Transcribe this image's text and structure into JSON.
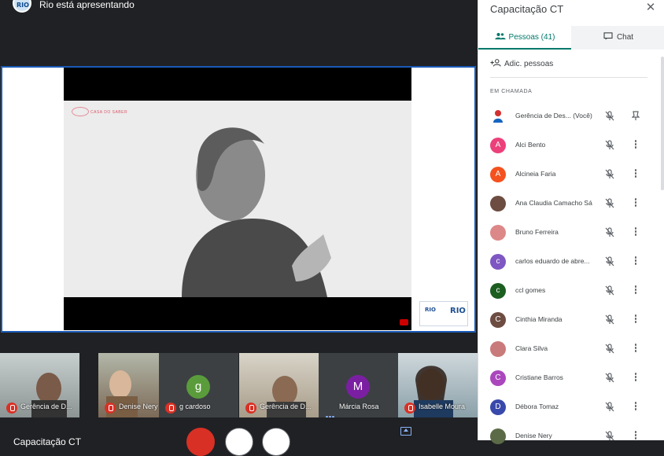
{
  "header": {
    "logo_text": "RIO",
    "presenting_text": "Rio está apresentando"
  },
  "video": {
    "brand_text": "CASA DO SABER",
    "badge_left": "RIO",
    "badge_right": "RIO"
  },
  "tiles": [
    {
      "name": "Gerência de D...",
      "muted": true,
      "avatar": "",
      "avatar_color": ""
    },
    {
      "name": "Denise Nery",
      "muted": true,
      "avatar": "",
      "avatar_color": ""
    },
    {
      "name": "g cardoso",
      "muted": true,
      "avatar": "g",
      "avatar_color": "#5a9c3b"
    },
    {
      "name": "Gerência de D...",
      "muted": true,
      "avatar": "",
      "avatar_color": ""
    },
    {
      "name": "Márcia Rosa",
      "muted": false,
      "avatar": "M",
      "avatar_color": "#7b1fa2"
    },
    {
      "name": "Isabelle Moura",
      "muted": true,
      "avatar": "",
      "avatar_color": ""
    }
  ],
  "bottom": {
    "meeting_title": "Capacitação CT"
  },
  "panel": {
    "title": "Capacitação CT",
    "tab_people": "Pessoas (41)",
    "tab_chat": "Chat",
    "add_people": "Adic. pessoas",
    "section_label": "EM CHAMADA",
    "participants": [
      {
        "name": "Gerência de Des... (Você)",
        "initial": "",
        "color": "#ffffff"
      },
      {
        "name": "Alci Bento",
        "initial": "A",
        "color": "#ec407a"
      },
      {
        "name": "Alcineia Faria",
        "initial": "A",
        "color": "#f4511e"
      },
      {
        "name": "Ana Claudia Camacho Sá",
        "initial": "",
        "color": "#6d4c41"
      },
      {
        "name": "Bruno Ferreira",
        "initial": "",
        "color": "#d88"
      },
      {
        "name": "carlos eduardo de abre...",
        "initial": "c",
        "color": "#7e57c2"
      },
      {
        "name": "ccl gomes",
        "initial": "c",
        "color": "#1b5e20"
      },
      {
        "name": "Cinthia Miranda",
        "initial": "C",
        "color": "#6d4c41"
      },
      {
        "name": "Clara Silva",
        "initial": "",
        "color": "#c97a7a"
      },
      {
        "name": "Cristiane Barros",
        "initial": "C",
        "color": "#ab47bc"
      },
      {
        "name": "Débora Tomaz",
        "initial": "D",
        "color": "#3949ab"
      },
      {
        "name": "Denise Nery",
        "initial": "",
        "color": "#5b6b47"
      }
    ]
  }
}
